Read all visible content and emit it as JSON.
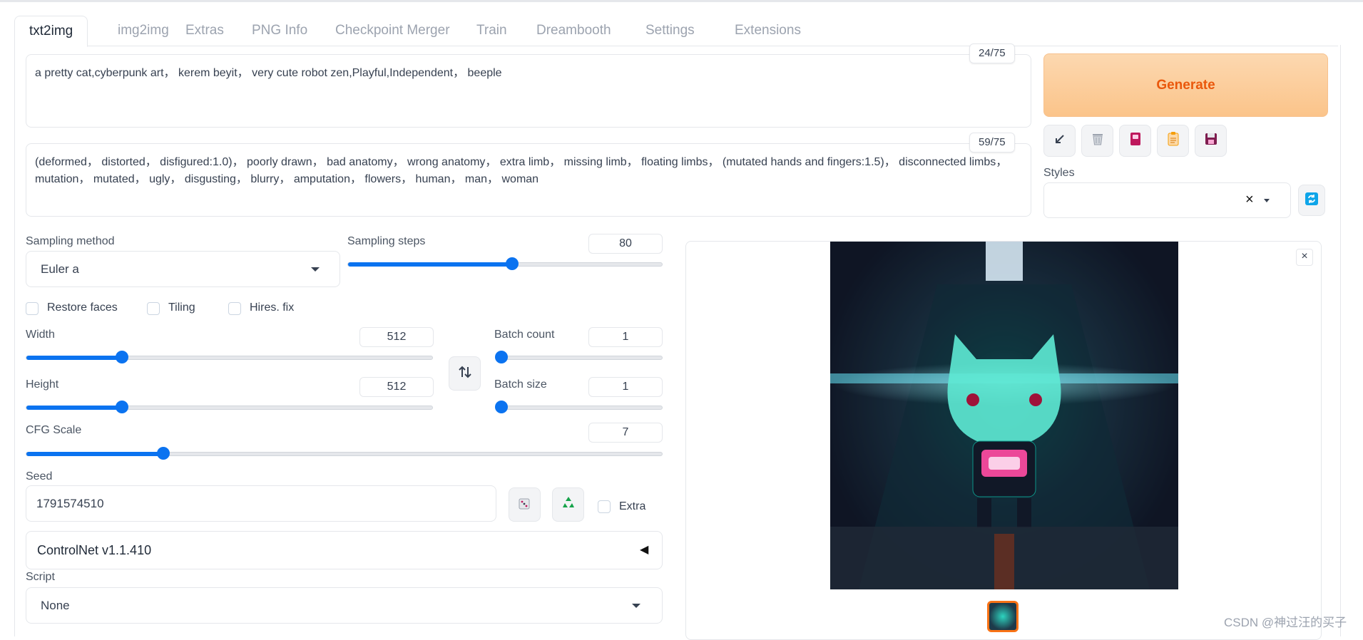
{
  "tabs": [
    "txt2img",
    "img2img",
    "Extras",
    "PNG Info",
    "Checkpoint Merger",
    "Train",
    "Dreambooth",
    "Settings",
    "Extensions"
  ],
  "active_tab": 0,
  "prompt": {
    "text": "a pretty cat,cyberpunk art， kerem beyit， very cute robot zen,Playful,Independent， beeple",
    "counter": "24/75"
  },
  "negative_prompt": {
    "text": "(deformed， distorted， disfigured:1.0)， poorly drawn， bad anatomy， wrong anatomy， extra limb， missing limb， floating limbs， (mutated hands and fingers:1.5)， disconnected limbs， mutation， mutated， ugly， disgusting， blurry， amputation， flowers， human， man， woman",
    "counter": "59/75"
  },
  "generate_label": "Generate",
  "tools": [
    "arrow-icon",
    "trash-icon",
    "style-book-icon",
    "clipboard-icon",
    "save-icon"
  ],
  "styles": {
    "label": "Styles",
    "value": ""
  },
  "sampling": {
    "method_label": "Sampling method",
    "method_value": "Euler a",
    "steps_label": "Sampling steps",
    "steps_value": "80",
    "steps_fraction": 0.52
  },
  "checkboxes": {
    "restore_faces": "Restore faces",
    "tiling": "Tiling",
    "hires_fix": "Hires. fix"
  },
  "width": {
    "label": "Width",
    "value": "512",
    "fraction": 0.235
  },
  "height": {
    "label": "Height",
    "value": "512",
    "fraction": 0.235
  },
  "batch_count": {
    "label": "Batch count",
    "value": "1",
    "fraction": 0.0
  },
  "batch_size": {
    "label": "Batch size",
    "value": "1",
    "fraction": 0.0
  },
  "cfg": {
    "label": "CFG Scale",
    "value": "7",
    "fraction": 0.215
  },
  "seed": {
    "label": "Seed",
    "value": "1791574510",
    "extra_label": "Extra"
  },
  "controlnet": {
    "label": "ControlNet v1.1.410"
  },
  "script": {
    "label": "Script",
    "value": "None"
  },
  "watermark": "CSDN @神过汪的买子"
}
